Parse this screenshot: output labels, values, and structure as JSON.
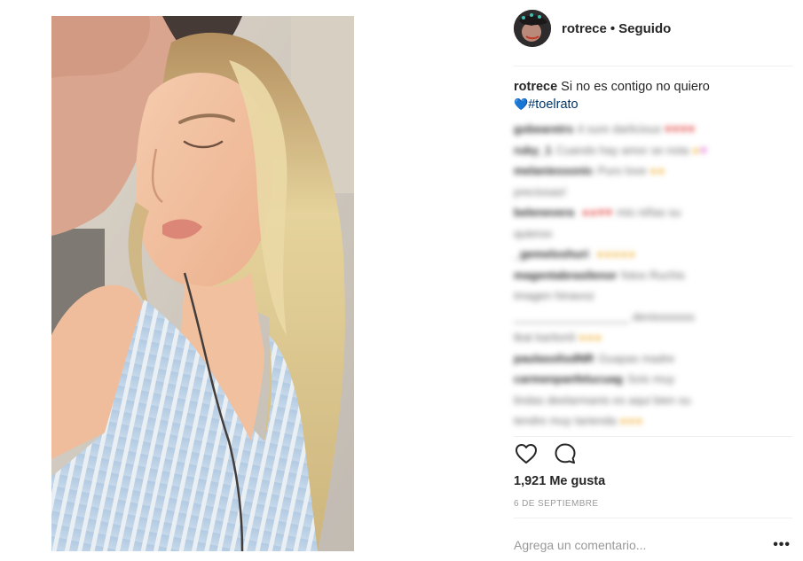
{
  "post": {
    "username": "rotrece",
    "separator": "•",
    "follow_status": "Seguido",
    "caption_text": "Si no es contigo no quiero",
    "caption_emoji": "💙",
    "caption_hashtag": "#toelrato",
    "likes": "1,921 Me gusta",
    "date": "6 DE SEPTIEMBRE"
  },
  "comments": [
    {
      "user": "gobearetrs",
      "text": "it sure darlicious",
      "emoji": "♥♥♥♥",
      "emoji_type": "red"
    },
    {
      "user": "ruby_1",
      "text": "Cuando hay amor se nota",
      "emoji": "●",
      "emoji_type": "yel",
      "emoji2": "♥",
      "emoji2_type": "pink"
    },
    {
      "user": "melaniessonic",
      "text": "Puro love",
      "emoji": "●●",
      "emoji_type": "yel"
    },
    {
      "user": "",
      "text": "preciosas!",
      "emoji": "",
      "emoji_type": ""
    },
    {
      "user": "belenevera",
      "text": "",
      "emoji": "●●♥♥",
      "emoji_type": "red",
      "trail": "mis niñas su"
    },
    {
      "user": "",
      "text": "quieroo",
      "emoji": "",
      "emoji_type": ""
    },
    {
      "user": "_gemeloshuri",
      "text": "",
      "emoji": "●●●●●",
      "emoji_type": "yel"
    },
    {
      "user": "magentabrasilenor",
      "text": "fotos Ruchis",
      "emoji": "",
      "emoji_type": ""
    },
    {
      "user": "",
      "text": "imagen hinavoz",
      "emoji": "",
      "emoji_type": ""
    },
    {
      "user": "",
      "text": "__________________ denisssssss",
      "emoji": "",
      "emoji_type": ""
    },
    {
      "user": "",
      "text": "tkat karitoriii",
      "emoji": "●●●",
      "emoji_type": "yel"
    },
    {
      "user": "paulasolisdNR",
      "text": "Guapas madre",
      "emoji": "",
      "emoji_type": ""
    },
    {
      "user": "carmenpanfelucuag",
      "text": "Sois muy",
      "emoji": "",
      "emoji_type": ""
    },
    {
      "user": "",
      "text": "lindas deelarmanis es aqui bien su",
      "emoji": "",
      "emoji_type": ""
    },
    {
      "user": "",
      "text": "tendre muy tarienda",
      "emoji": "●●●",
      "emoji_type": "yel"
    }
  ],
  "add_comment": {
    "placeholder": "Agrega un comentario..."
  },
  "more_label": "•••",
  "icons": {
    "like": "heart-outline-icon",
    "comment": "comment-bubble-icon"
  }
}
